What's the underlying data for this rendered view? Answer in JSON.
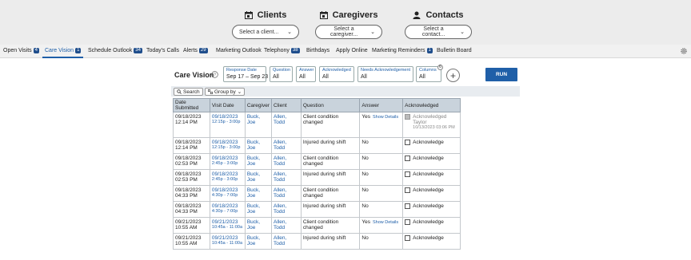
{
  "header": {
    "clients": {
      "title": "Clients",
      "placeholder": "Select a client..."
    },
    "caregivers": {
      "title": "Caregivers",
      "placeholder": "Select a caregiver..."
    },
    "contacts": {
      "title": "Contacts",
      "placeholder": "Select a contact..."
    }
  },
  "nav": {
    "items": [
      {
        "label": "Open Visits",
        "badge": "4"
      },
      {
        "label": "Care Vision",
        "badge": "1"
      },
      {
        "label": "Schedule Outlook",
        "badge": "34"
      },
      {
        "label": "Today's Calls",
        "badge": ""
      },
      {
        "label": "Alerts",
        "badge": "29"
      },
      {
        "label": "Marketing Outlook",
        "badge": ""
      },
      {
        "label": "Telephony",
        "badge": "38"
      },
      {
        "label": "Birthdays",
        "badge": ""
      },
      {
        "label": "Apply Online",
        "badge": ""
      },
      {
        "label": "Marketing Reminders",
        "badge": "1"
      },
      {
        "label": "Bulletin Board",
        "badge": ""
      }
    ]
  },
  "page": {
    "title": "Care Vision",
    "run_label": "RUN",
    "columns_count": "6"
  },
  "filters": [
    {
      "label": "Response Date",
      "value": "Sep 17 – Sep 23"
    },
    {
      "label": "Question",
      "value": "All"
    },
    {
      "label": "Answer",
      "value": "All"
    },
    {
      "label": "Acknowledged",
      "value": "All"
    },
    {
      "label": "Needs Acknowledgement",
      "value": "All"
    },
    {
      "label": "Columns",
      "value": "All"
    }
  ],
  "toolbar": {
    "search_label": "Search",
    "groupby_label": "Group by"
  },
  "table": {
    "headers": [
      "Date Submitted",
      "Visit Date",
      "Caregiver",
      "Client",
      "Question",
      "Answer",
      "Acknowledged"
    ],
    "rows": [
      {
        "date": "09/18/2023",
        "time": "12:14 PM",
        "visit_date": "09/18/2023",
        "visit_time": "12:15p - 3:00p",
        "caregiver": "Buck, Joe",
        "client": "Allen, Todd",
        "question": "Client condition changed",
        "answer": "Yes",
        "details": "Show Details",
        "ack": "Acknowledged",
        "ack_by": "Taylor",
        "ack_at": "10/13/2023 03:06 PM",
        "checked": true
      },
      {
        "date": "09/18/2023",
        "time": "12:14 PM",
        "visit_date": "09/18/2023",
        "visit_time": "12:15p - 3:00p",
        "caregiver": "Buck, Joe",
        "client": "Allen, Todd",
        "question": "Injured during shift",
        "answer": "No",
        "details": "",
        "ack": "Acknowledge",
        "checked": false
      },
      {
        "date": "09/18/2023",
        "time": "02:53 PM",
        "visit_date": "09/18/2023",
        "visit_time": "2:45p - 3:00p",
        "caregiver": "Buck, Joe",
        "client": "Allen, Todd",
        "question": "Client condition changed",
        "answer": "No",
        "details": "",
        "ack": "Acknowledge",
        "checked": false
      },
      {
        "date": "09/18/2023",
        "time": "02:53 PM",
        "visit_date": "09/18/2023",
        "visit_time": "2:45p - 3:00p",
        "caregiver": "Buck, Joe",
        "client": "Allen, Todd",
        "question": "Injured during shift",
        "answer": "No",
        "details": "",
        "ack": "Acknowledge",
        "checked": false
      },
      {
        "date": "09/18/2023",
        "time": "04:33 PM",
        "visit_date": "09/18/2023",
        "visit_time": "4:30p - 7:00p",
        "caregiver": "Buck, Joe",
        "client": "Allen, Todd",
        "question": "Client condition changed",
        "answer": "No",
        "details": "",
        "ack": "Acknowledge",
        "checked": false
      },
      {
        "date": "09/18/2023",
        "time": "04:33 PM",
        "visit_date": "09/18/2023",
        "visit_time": "4:30p - 7:00p",
        "caregiver": "Buck, Joe",
        "client": "Allen, Todd",
        "question": "Injured during shift",
        "answer": "No",
        "details": "",
        "ack": "Acknowledge",
        "checked": false
      },
      {
        "date": "09/21/2023",
        "time": "10:55 AM",
        "visit_date": "09/21/2023",
        "visit_time": "10:45a - 11:00a",
        "caregiver": "Buck, Joe",
        "client": "Allen, Todd",
        "question": "Client condition changed",
        "answer": "Yes",
        "details": "Show Details",
        "ack": "Acknowledge",
        "checked": false
      },
      {
        "date": "09/21/2023",
        "time": "10:55 AM",
        "visit_date": "09/21/2023",
        "visit_time": "10:45a - 11:00a",
        "caregiver": "Buck, Joe",
        "client": "Allen, Todd",
        "question": "Injured during shift",
        "answer": "No",
        "details": "",
        "ack": "Acknowledge",
        "checked": false
      }
    ]
  }
}
